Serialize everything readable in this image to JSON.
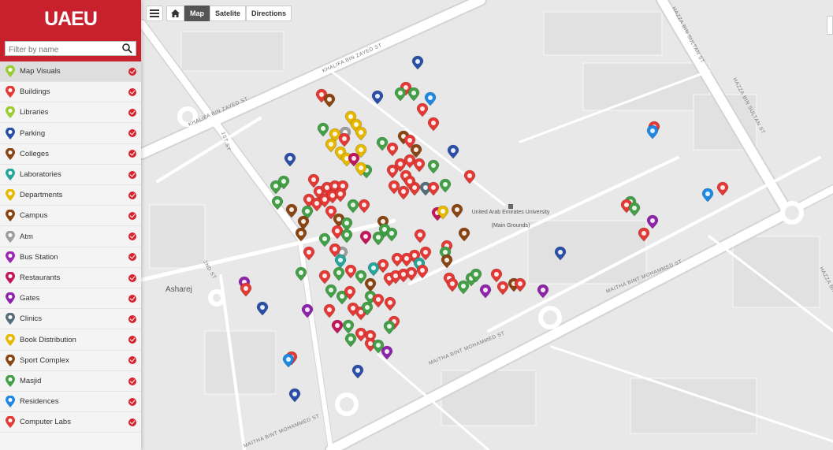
{
  "brand": {
    "logo_text": "UAEU",
    "color": "#c8202c"
  },
  "filter": {
    "placeholder": "Filter by name"
  },
  "layers": [
    {
      "label": "Map Visuals",
      "color": "#9acd32",
      "checked": true
    },
    {
      "label": "Buildings",
      "color": "#e53935",
      "checked": true
    },
    {
      "label": "Libraries",
      "color": "#9acd32",
      "checked": true
    },
    {
      "label": "Parking",
      "color": "#2a4fa8",
      "checked": true
    },
    {
      "label": "Colleges",
      "color": "#8b4513",
      "checked": true
    },
    {
      "label": "Laboratories",
      "color": "#26a69a",
      "checked": true
    },
    {
      "label": "Departments",
      "color": "#e6b800",
      "checked": true
    },
    {
      "label": "Campus",
      "color": "#8b4513",
      "checked": true
    },
    {
      "label": "Atm",
      "color": "#9e9e9e",
      "checked": true
    },
    {
      "label": "Bus Station",
      "color": "#9c27b0",
      "checked": true
    },
    {
      "label": "Restaurants",
      "color": "#c2185b",
      "checked": true
    },
    {
      "label": "Gates",
      "color": "#8e24aa",
      "checked": true
    },
    {
      "label": "Clinics",
      "color": "#546e7a",
      "checked": true
    },
    {
      "label": "Book Distribution",
      "color": "#e6b800",
      "checked": true
    },
    {
      "label": "Sport Complex",
      "color": "#8b4513",
      "checked": true
    },
    {
      "label": "Masjid",
      "color": "#43a047",
      "checked": true
    },
    {
      "label": "Residences",
      "color": "#1e88e5",
      "checked": true
    },
    {
      "label": "Computer Labs",
      "color": "#e53935",
      "checked": true
    }
  ],
  "toolbar": {
    "map": "Map",
    "satellite": "Satelite",
    "directions": "Directions"
  },
  "map": {
    "place_name": "United Arab Emirates University",
    "place_sub": "(Main Grounds)",
    "district": "Asharej",
    "streets": {
      "khalifa_1": "KHALIFA BIN ZAYED ST",
      "khalifa_2": "KHALIFA BIN ZAYED ST",
      "hazza_1": "HAZZA BIN SULTAN ST",
      "hazza_2": "HAZZA BIN SULTAN ST",
      "hazza_3": "HAZZA BIN SULTAN ST",
      "maitha_1": "MAITHA BINT MOHAMMED ST",
      "maitha_2": "MAITHA BINT MOHAMMED ST",
      "maitha_3": "MAITHA BINT MOHAMMED ST",
      "st_1st": "1ST ST",
      "st_2nd": "2ND ST"
    },
    "marker_colors": {
      "building": "#e53935",
      "masjid": "#43a047",
      "department": "#e6b800",
      "parking": "#2a4fa8",
      "college": "#8b4513",
      "gate": "#8e24aa",
      "residence": "#1e88e5",
      "lab": "#26a69a",
      "atm": "#9e9e9e",
      "clinic": "#546e7a",
      "restaurant": "#c2185b"
    }
  }
}
